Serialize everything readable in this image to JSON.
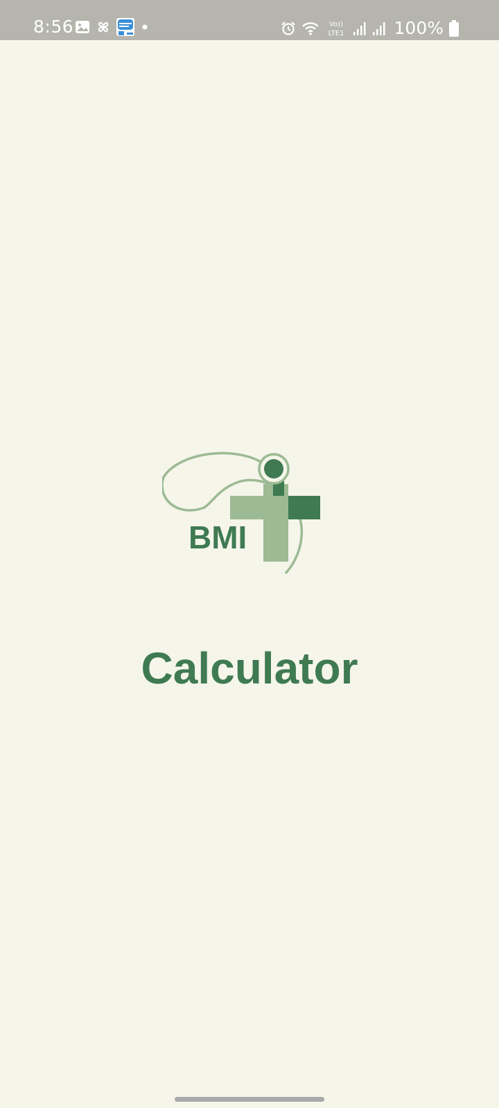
{
  "status_bar": {
    "time": "8:56",
    "battery": "100%",
    "left_icons": [
      "gallery-icon",
      "pinwheel-icon",
      "app-notification-icon",
      "dot-icon"
    ],
    "right_icons": [
      "alarm-icon",
      "wifi-icon",
      "volte-icon",
      "signal-icon",
      "signal-icon",
      "battery-icon"
    ],
    "volte_label": "Vo))",
    "lte_label": "LTE1"
  },
  "splash": {
    "logo_text": "BMI",
    "title": "Calculator"
  },
  "colors": {
    "background": "#f5f5ea",
    "status_bar": "#b5b5ad",
    "brand_dark_green": "#3f7a52",
    "brand_light_green": "#9cba93"
  }
}
